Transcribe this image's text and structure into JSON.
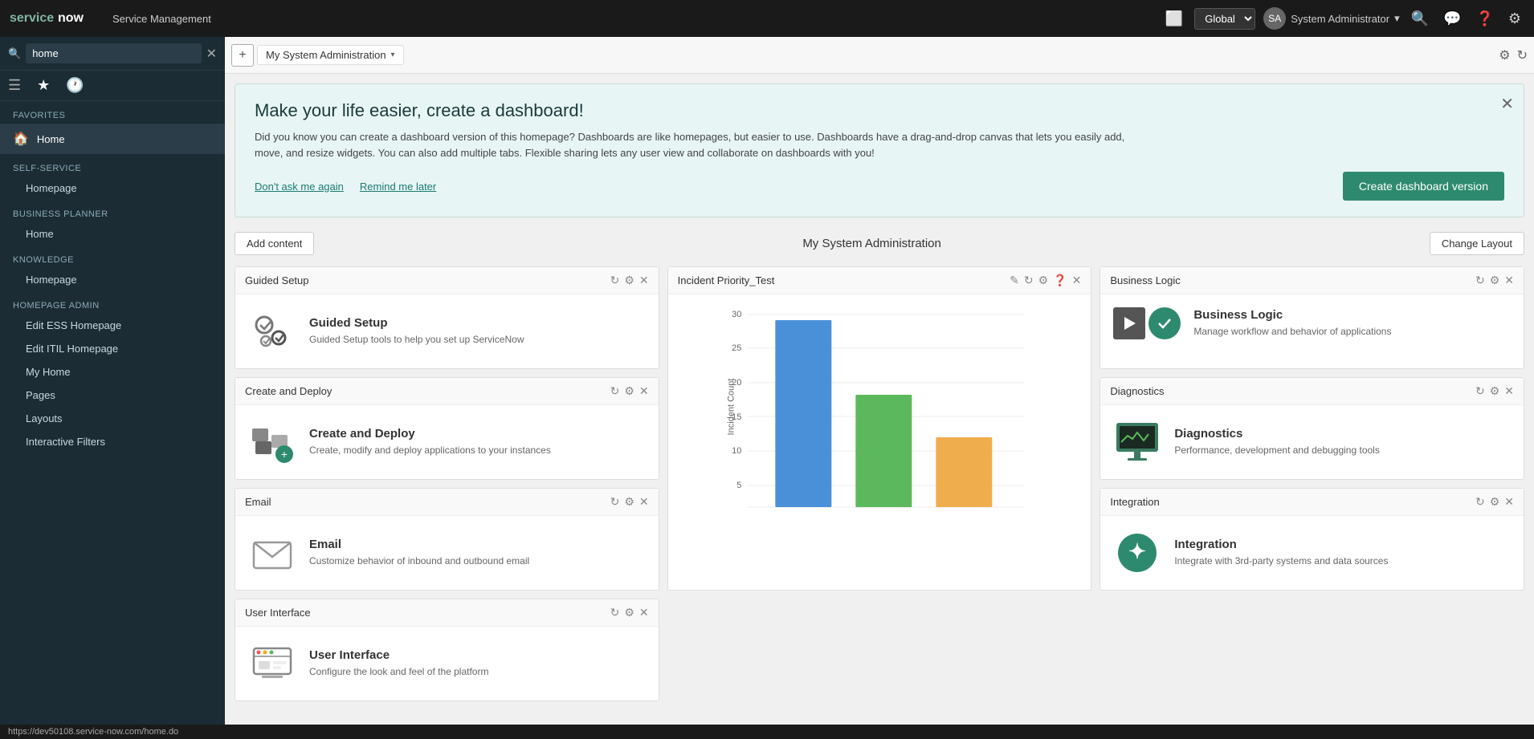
{
  "topnav": {
    "logo": "servicenow",
    "app_name": "Service Management",
    "global_label": "Global",
    "user_name": "System Administrator",
    "icons": [
      "window-icon",
      "chat-icon",
      "help-icon",
      "settings-icon"
    ]
  },
  "tabbar": {
    "add_button": "+",
    "current_tab": "My System Administration",
    "settings_icon": "⚙",
    "refresh_icon": "↻"
  },
  "sidebar": {
    "search_placeholder": "home",
    "search_value": "home",
    "sections": [
      {
        "label": "Favorites",
        "items": [
          {
            "name": "Home",
            "icon": "🏠",
            "active": true
          },
          {
            "name": "Self-Service",
            "icon": "",
            "is_group": true
          },
          {
            "name": "Homepage",
            "indent": true
          },
          {
            "name": "Business Planner",
            "is_group": true
          },
          {
            "name": "Home",
            "indent": true
          },
          {
            "name": "Knowledge",
            "is_group": true
          },
          {
            "name": "Homepage",
            "indent": true
          },
          {
            "name": "Homepage Admin",
            "is_group": true
          },
          {
            "name": "Edit ESS Homepage",
            "indent": true
          },
          {
            "name": "Edit ITIL Homepage",
            "indent": true
          },
          {
            "name": "My Home",
            "indent": true
          },
          {
            "name": "Pages",
            "indent": true
          },
          {
            "name": "Layouts",
            "indent": true
          },
          {
            "name": "Interactive Filters",
            "indent": true
          }
        ]
      }
    ]
  },
  "banner": {
    "title": "Make your life easier, create a dashboard!",
    "body": "Did you know you can create a dashboard version of this homepage? Dashboards are like homepages, but easier to use. Dashboards have a drag-and-drop canvas that lets you easily add, move, and resize widgets. You can also add multiple tabs. Flexible sharing lets any user view and collaborate on dashboards with you!",
    "link1": "Don't ask me again",
    "link2": "Remind me later",
    "create_btn": "Create dashboard version"
  },
  "dashboard": {
    "add_content_btn": "Add content",
    "title": "My System Administration",
    "change_layout_btn": "Change Layout"
  },
  "widgets": [
    {
      "id": "guided-setup",
      "title": "Guided Setup",
      "icon_type": "gears",
      "heading": "Guided Setup",
      "description": "Guided Setup tools to help you set up ServiceNow"
    },
    {
      "id": "incident-priority",
      "title": "Incident Priority_Test",
      "type": "chart",
      "chart": {
        "y_axis_label": "Incident Count",
        "y_labels": [
          "30",
          "25",
          "20",
          "15",
          "10",
          "5"
        ],
        "bars": [
          {
            "height_pct": 87,
            "color": "#4a90d9",
            "label": ""
          },
          {
            "height_pct": 53,
            "color": "#5cb85c",
            "label": ""
          },
          {
            "height_pct": 33,
            "color": "#f0ad4e",
            "label": ""
          }
        ]
      }
    },
    {
      "id": "business-logic",
      "title": "Business Logic",
      "icon_type": "bl",
      "heading": "Business Logic",
      "description": "Manage workflow and behavior of applications"
    },
    {
      "id": "create-deploy",
      "title": "Create and Deploy",
      "icon_type": "deploy",
      "heading": "Create and Deploy",
      "description": "Create, modify and deploy applications to your instances"
    },
    {
      "id": "diagnostics",
      "title": "Diagnostics",
      "icon_type": "diag",
      "heading": "Diagnostics",
      "description": "Performance, development and debugging tools"
    },
    {
      "id": "email",
      "title": "Email",
      "icon_type": "email",
      "heading": "Email",
      "description": "Customize behavior of inbound and outbound email"
    },
    {
      "id": "integration",
      "title": "Integration",
      "icon_type": "intg",
      "heading": "Integration",
      "description": "Integrate with 3rd-party systems and data sources"
    },
    {
      "id": "user-interface",
      "title": "User Interface",
      "icon_type": "ui",
      "heading": "User Interface",
      "description": "Configure the look and feel of the platform"
    }
  ],
  "statusbar": {
    "url": "https://dev50108.service-now.com/home.do"
  }
}
